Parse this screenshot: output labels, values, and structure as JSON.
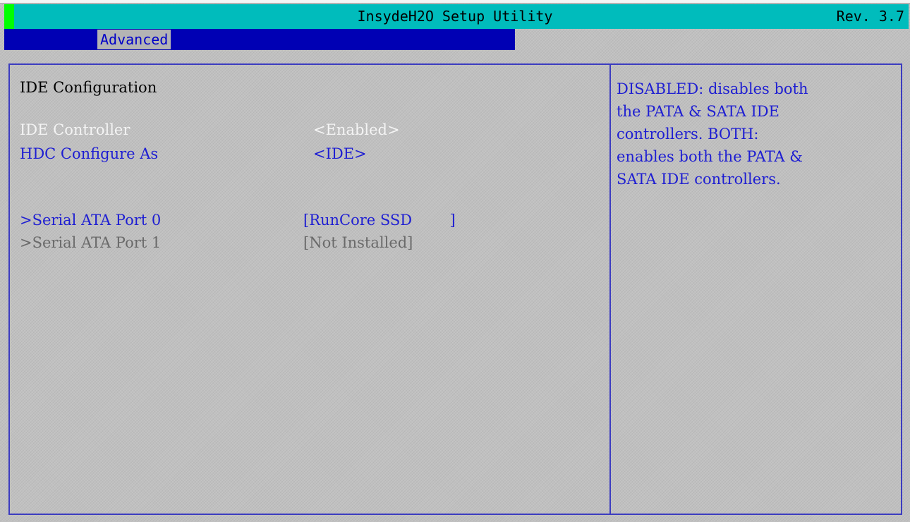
{
  "window": {
    "title": "InsydeH2O Setup Utility",
    "revision": "Rev. 3.7"
  },
  "menu": {
    "active_tab": "Advanced"
  },
  "page": {
    "heading": "IDE Configuration"
  },
  "settings": [
    {
      "label": "IDE Controller",
      "value": "<Enabled>",
      "state": "selected"
    },
    {
      "label": "HDC Configure As",
      "value": "<IDE>",
      "state": "normal"
    }
  ],
  "ports": [
    {
      "label": ">Serial ATA Port 0",
      "value": "[RunCore SSD        ]",
      "state": "normal"
    },
    {
      "label": ">Serial ATA Port 1",
      "value": "[Not Installed]",
      "state": "disabled"
    }
  ],
  "help": {
    "text": "DISABLED: disables both\nthe PATA & SATA IDE\ncontrollers. BOTH:\nenables both the PATA &\nSATA IDE controllers."
  },
  "colors": {
    "title_bar": "#00bcbc",
    "menu_bar": "#0000b4",
    "background": "#c0c0c0",
    "item_text": "#1e1ed2",
    "selected_text": "#f4f4f4",
    "disabled_text": "#6a6a6a",
    "frame": "#3c3cc0",
    "marker": "#00ff00"
  }
}
